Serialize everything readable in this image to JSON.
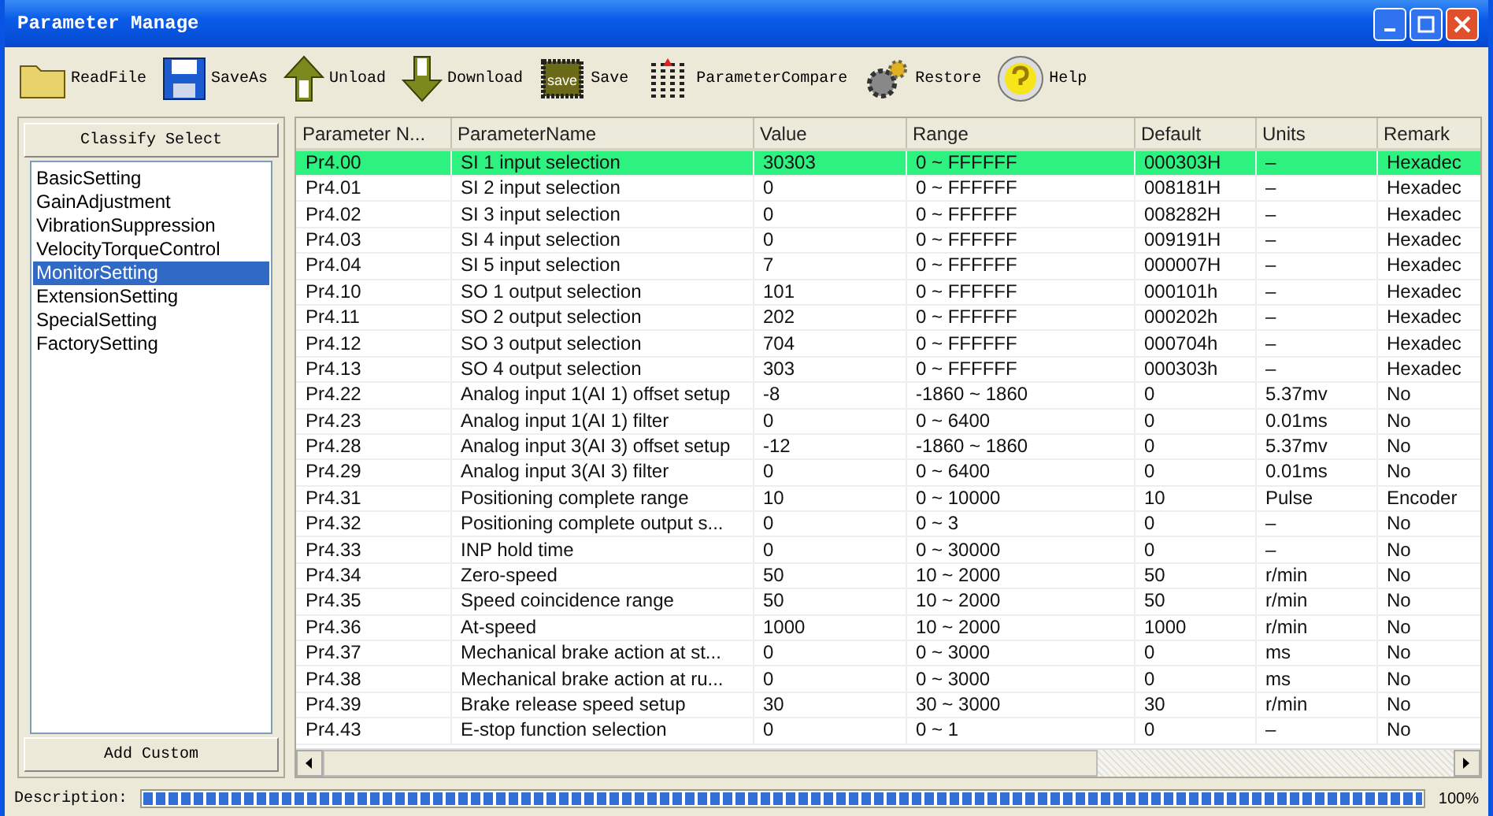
{
  "window": {
    "title": "Parameter Manage"
  },
  "toolbar": [
    {
      "label": "ReadFile",
      "kind": "folder"
    },
    {
      "label": "SaveAs",
      "kind": "floppy"
    },
    {
      "label": "Unload",
      "kind": "up"
    },
    {
      "label": "Download",
      "kind": "down"
    },
    {
      "label": "Save",
      "kind": "chip",
      "icon_text": "save"
    },
    {
      "label": "ParameterCompare",
      "kind": "compare"
    },
    {
      "label": "Restore",
      "kind": "gears"
    },
    {
      "label": "Help",
      "kind": "help"
    }
  ],
  "sidebar": {
    "header": "Classify Select",
    "footer_button": "Add Custom",
    "items": [
      {
        "label": "BasicSetting",
        "selected": false
      },
      {
        "label": "GainAdjustment",
        "selected": false
      },
      {
        "label": "VibrationSuppression",
        "selected": false
      },
      {
        "label": "VelocityTorqueControl",
        "selected": false
      },
      {
        "label": "MonitorSetting",
        "selected": true
      },
      {
        "label": "ExtensionSetting",
        "selected": false
      },
      {
        "label": "SpecialSetting",
        "selected": false
      },
      {
        "label": "FactorySetting",
        "selected": false
      }
    ]
  },
  "table": {
    "columns": [
      "Parameter N...",
      "ParameterName",
      "Value",
      "Range",
      "Default",
      "Units",
      "Remark"
    ],
    "rows": [
      {
        "selected": true,
        "cells": [
          "Pr4.00",
          "SI 1 input selection",
          "30303",
          "0 ~ FFFFFF",
          "000303H",
          "–",
          "Hexadec"
        ]
      },
      {
        "selected": false,
        "cells": [
          "Pr4.01",
          "SI 2 input selection",
          "0",
          "0 ~ FFFFFF",
          "008181H",
          "–",
          "Hexadec"
        ]
      },
      {
        "selected": false,
        "cells": [
          "Pr4.02",
          "SI 3 input selection",
          "0",
          "0 ~ FFFFFF",
          "008282H",
          "–",
          "Hexadec"
        ]
      },
      {
        "selected": false,
        "cells": [
          "Pr4.03",
          "SI 4 input selection",
          "0",
          "0 ~ FFFFFF",
          "009191H",
          "–",
          "Hexadec"
        ]
      },
      {
        "selected": false,
        "cells": [
          "Pr4.04",
          "SI 5 input selection",
          "7",
          "0 ~ FFFFFF",
          "000007H",
          "–",
          "Hexadec"
        ]
      },
      {
        "selected": false,
        "cells": [
          "Pr4.10",
          "SO 1 output selection",
          "101",
          "0 ~ FFFFFF",
          "000101h",
          "–",
          "Hexadec"
        ]
      },
      {
        "selected": false,
        "cells": [
          "Pr4.11",
          "SO 2 output selection",
          "202",
          "0 ~ FFFFFF",
          "000202h",
          "–",
          "Hexadec"
        ]
      },
      {
        "selected": false,
        "cells": [
          "Pr4.12",
          "SO 3 output selection",
          "704",
          "0 ~ FFFFFF",
          "000704h",
          "–",
          "Hexadec"
        ]
      },
      {
        "selected": false,
        "cells": [
          "Pr4.13",
          "SO 4 output selection",
          "303",
          "0 ~ FFFFFF",
          "000303h",
          "–",
          "Hexadec"
        ]
      },
      {
        "selected": false,
        "cells": [
          "Pr4.22",
          "Analog input 1(AI 1) offset setup",
          "-8",
          "-1860 ~ 1860",
          "0",
          "5.37mv",
          "No"
        ]
      },
      {
        "selected": false,
        "cells": [
          "Pr4.23",
          "Analog input 1(AI 1) filter",
          "0",
          "0 ~ 6400",
          "0",
          "0.01ms",
          "No"
        ]
      },
      {
        "selected": false,
        "cells": [
          "Pr4.28",
          "Analog input 3(AI 3) offset setup",
          "-12",
          "-1860 ~ 1860",
          "0",
          "5.37mv",
          "No"
        ]
      },
      {
        "selected": false,
        "cells": [
          "Pr4.29",
          "Analog input 3(AI 3) filter",
          "0",
          "0 ~ 6400",
          "0",
          "0.01ms",
          "No"
        ]
      },
      {
        "selected": false,
        "cells": [
          "Pr4.31",
          "Positioning complete range",
          "10",
          "0 ~ 10000",
          "10",
          "Pulse",
          "Encoder"
        ]
      },
      {
        "selected": false,
        "cells": [
          "Pr4.32",
          "Positioning complete output s...",
          "0",
          "0 ~ 3",
          "0",
          "–",
          "No"
        ]
      },
      {
        "selected": false,
        "cells": [
          "Pr4.33",
          "INP hold time",
          "0",
          "0 ~ 30000",
          "0",
          "–",
          "No"
        ]
      },
      {
        "selected": false,
        "cells": [
          "Pr4.34",
          "Zero-speed",
          "50",
          "10 ~ 2000",
          "50",
          "r/min",
          "No"
        ]
      },
      {
        "selected": false,
        "cells": [
          "Pr4.35",
          "Speed coincidence range",
          "50",
          "10 ~ 2000",
          "50",
          "r/min",
          "No"
        ]
      },
      {
        "selected": false,
        "cells": [
          "Pr4.36",
          "At-speed",
          "1000",
          "10 ~ 2000",
          "1000",
          "r/min",
          "No"
        ]
      },
      {
        "selected": false,
        "cells": [
          "Pr4.37",
          "Mechanical brake action at st...",
          "0",
          "0 ~ 3000",
          "0",
          "ms",
          "No"
        ]
      },
      {
        "selected": false,
        "cells": [
          "Pr4.38",
          "Mechanical brake action at ru...",
          "0",
          "0 ~ 3000",
          "0",
          "ms",
          "No"
        ]
      },
      {
        "selected": false,
        "cells": [
          "Pr4.39",
          "Brake release speed setup",
          "30",
          "30 ~ 3000",
          "30",
          "r/min",
          "No"
        ]
      },
      {
        "selected": false,
        "cells": [
          "Pr4.43",
          "E-stop function selection",
          "0",
          "0 ~ 1",
          "0",
          "–",
          "No"
        ]
      }
    ]
  },
  "status_bar": {
    "label": "Description:",
    "level": 1,
    "percent": "100%"
  }
}
